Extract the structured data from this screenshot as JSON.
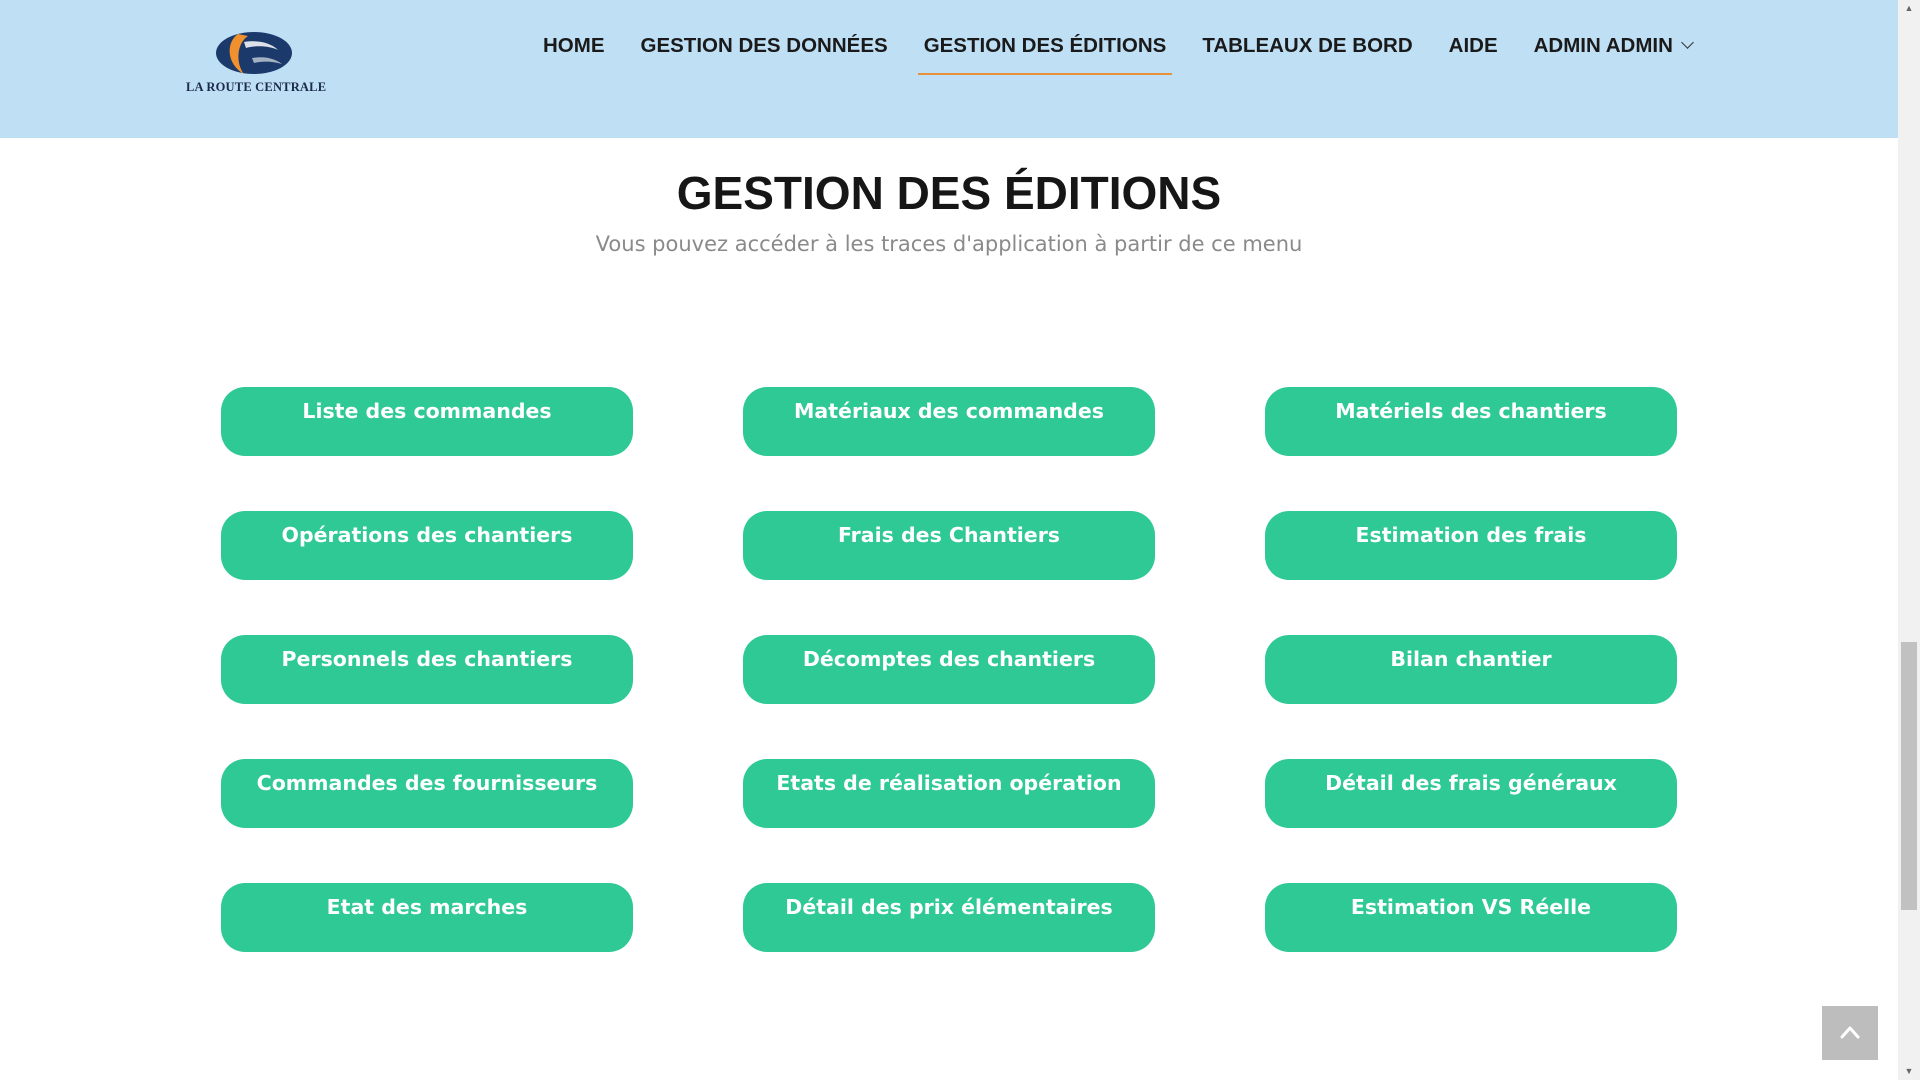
{
  "header": {
    "logo_text": "LA ROUTE CENTRALE",
    "nav": [
      {
        "label": "HOME",
        "active": false
      },
      {
        "label": "GESTION DES DONNÉES",
        "active": false
      },
      {
        "label": "GESTION DES ÉDITIONS",
        "active": true
      },
      {
        "label": "TABLEAUX DE BORD",
        "active": false
      },
      {
        "label": "AIDE",
        "active": false
      },
      {
        "label": "ADMIN ADMIN",
        "active": false,
        "icon": "chevron-down-icon"
      }
    ]
  },
  "main": {
    "title": "GESTION DES ÉDITIONS",
    "subtitle": "Vous pouvez accéder à les traces d'application à partir de ce menu",
    "buttons": [
      "Liste des commandes",
      "Matériaux des commandes",
      "Matériels des chantiers",
      "Opérations des chantiers",
      "Frais des Chantiers",
      "Estimation des frais",
      "Personnels des chantiers",
      "Décomptes des chantiers",
      "Bilan chantier",
      "Commandes des fournisseurs",
      "Etats de réalisation opération",
      "Détail des frais généraux",
      "Etat des marches",
      "Détail des prix élémentaires",
      "Estimation VS Réelle"
    ]
  },
  "colors": {
    "header_bg": "#bfdff5",
    "accent_underline": "#e8913a",
    "button_bg": "#2ec994",
    "logo_navy": "#1b3a6b",
    "logo_orange": "#f0912e"
  },
  "back_to_top": {
    "icon": "chevron-up-icon"
  }
}
